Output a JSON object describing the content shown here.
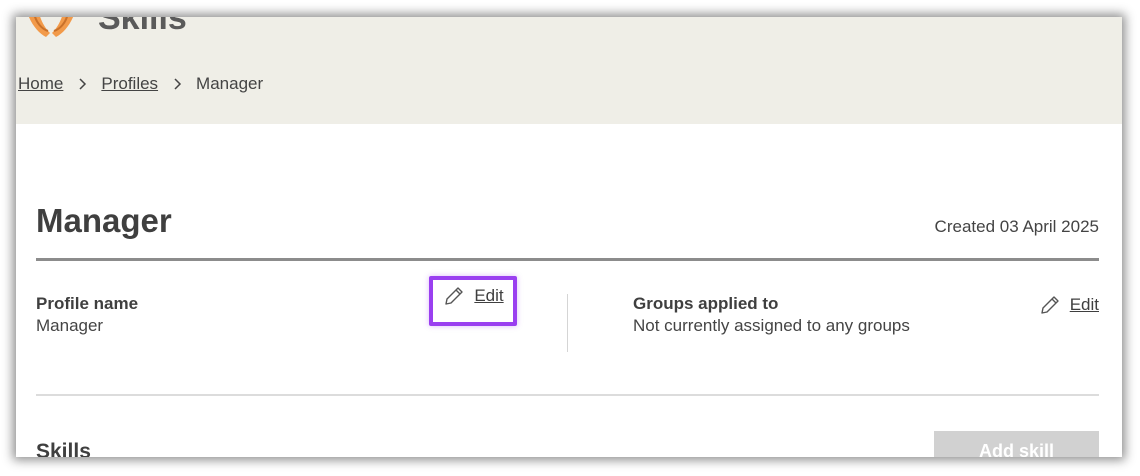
{
  "header": {
    "app_title": "Skills",
    "breadcrumb": [
      {
        "label": "Home"
      },
      {
        "label": "Profiles"
      },
      {
        "label": "Manager"
      }
    ]
  },
  "profile": {
    "title": "Manager",
    "created": "Created 03 April 2025",
    "fields": {
      "name_label": "Profile name",
      "name_value": "Manager",
      "groups_label": "Groups applied to",
      "groups_value": "Not currently assigned to any groups"
    },
    "edit_label": "Edit"
  },
  "skills_section": {
    "title": "Skills",
    "add_button_label": "Add skill"
  },
  "colors": {
    "header_bg": "#efeee7",
    "highlight": "#9a3ff0",
    "logo": "#f29a4a",
    "button_disabled": "#d1d1d1"
  },
  "icons": [
    "hands-logo-icon",
    "chevron-right-icon",
    "pencil-icon"
  ]
}
